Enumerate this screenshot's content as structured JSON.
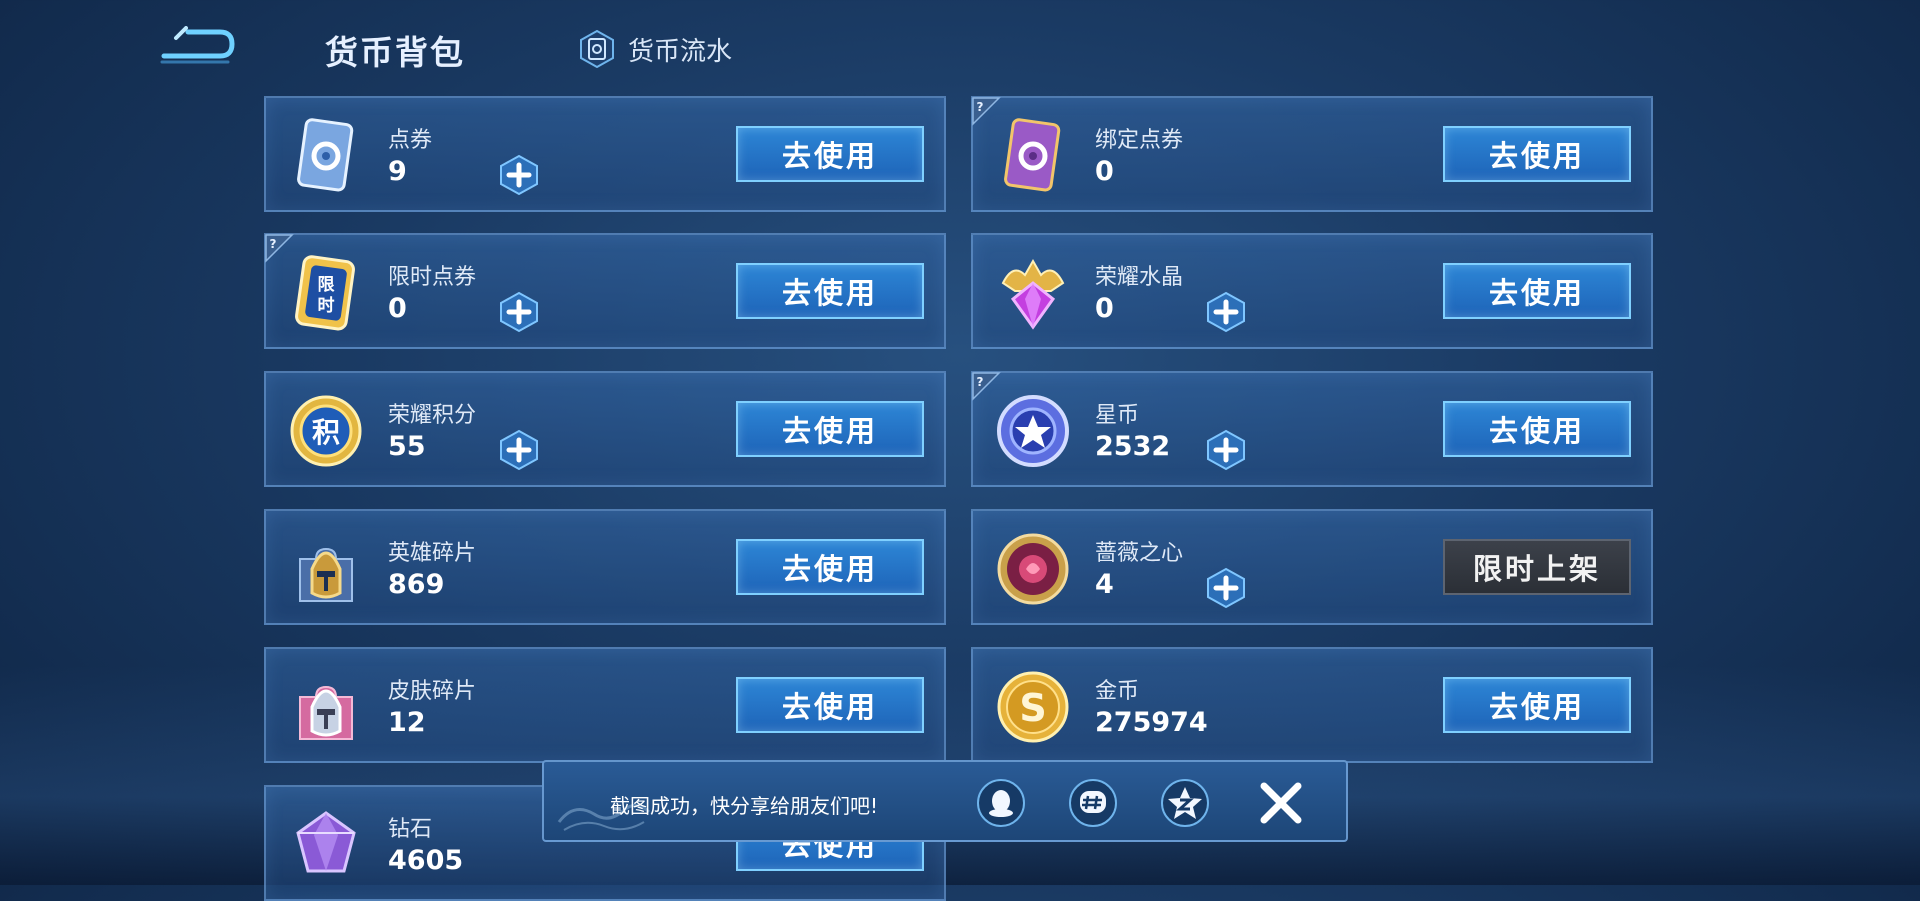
{
  "header": {
    "title": "货币背包",
    "flow_tab_label": "货币流水"
  },
  "left_column": [
    {
      "name": "点券",
      "value": "9",
      "has_plus": true,
      "has_help": false,
      "button": "去使用",
      "button_style": "blue",
      "icon": "voucher-card-icon"
    },
    {
      "name": "限时点券",
      "value": "0",
      "has_plus": true,
      "has_help": true,
      "button": "去使用",
      "button_style": "blue",
      "icon": "limited-voucher-icon"
    },
    {
      "name": "荣耀积分",
      "value": "55",
      "has_plus": true,
      "has_help": false,
      "button": "去使用",
      "button_style": "blue",
      "icon": "glory-points-coin-icon"
    },
    {
      "name": "英雄碎片",
      "value": "869",
      "has_plus": false,
      "has_help": false,
      "button": "去使用",
      "button_style": "blue",
      "icon": "hero-fragment-icon"
    },
    {
      "name": "皮肤碎片",
      "value": "12",
      "has_plus": false,
      "has_help": false,
      "button": "去使用",
      "button_style": "blue",
      "icon": "skin-fragment-icon"
    },
    {
      "name": "钻石",
      "value": "4605",
      "has_plus": false,
      "has_help": false,
      "button": "去使用",
      "button_style": "blue",
      "icon": "diamond-icon"
    }
  ],
  "right_column": [
    {
      "name": "绑定点券",
      "value": "0",
      "has_plus": false,
      "has_help": true,
      "button": "去使用",
      "button_style": "blue",
      "icon": "bound-voucher-card-icon"
    },
    {
      "name": "荣耀水晶",
      "value": "0",
      "has_plus": true,
      "has_help": false,
      "button": "去使用",
      "button_style": "blue",
      "icon": "glory-crystal-icon"
    },
    {
      "name": "星币",
      "value": "2532",
      "has_plus": true,
      "has_help": true,
      "button": "去使用",
      "button_style": "blue",
      "icon": "star-coin-icon"
    },
    {
      "name": "蔷薇之心",
      "value": "4",
      "has_plus": true,
      "has_help": false,
      "button": "限时上架",
      "button_style": "gray",
      "icon": "rose-heart-icon"
    },
    {
      "name": "金币",
      "value": "275974",
      "has_plus": false,
      "has_help": false,
      "button": "去使用",
      "button_style": "blue",
      "icon": "gold-coin-icon"
    }
  ],
  "toast": {
    "message": "截图成功，快分享给朋友们吧!"
  },
  "colors": {
    "button_blue": "#2d86d6",
    "button_border": "#7fd0ff",
    "button_gray": "#3c414a",
    "card_border": "#78aae1",
    "background": "#1a3a63"
  }
}
